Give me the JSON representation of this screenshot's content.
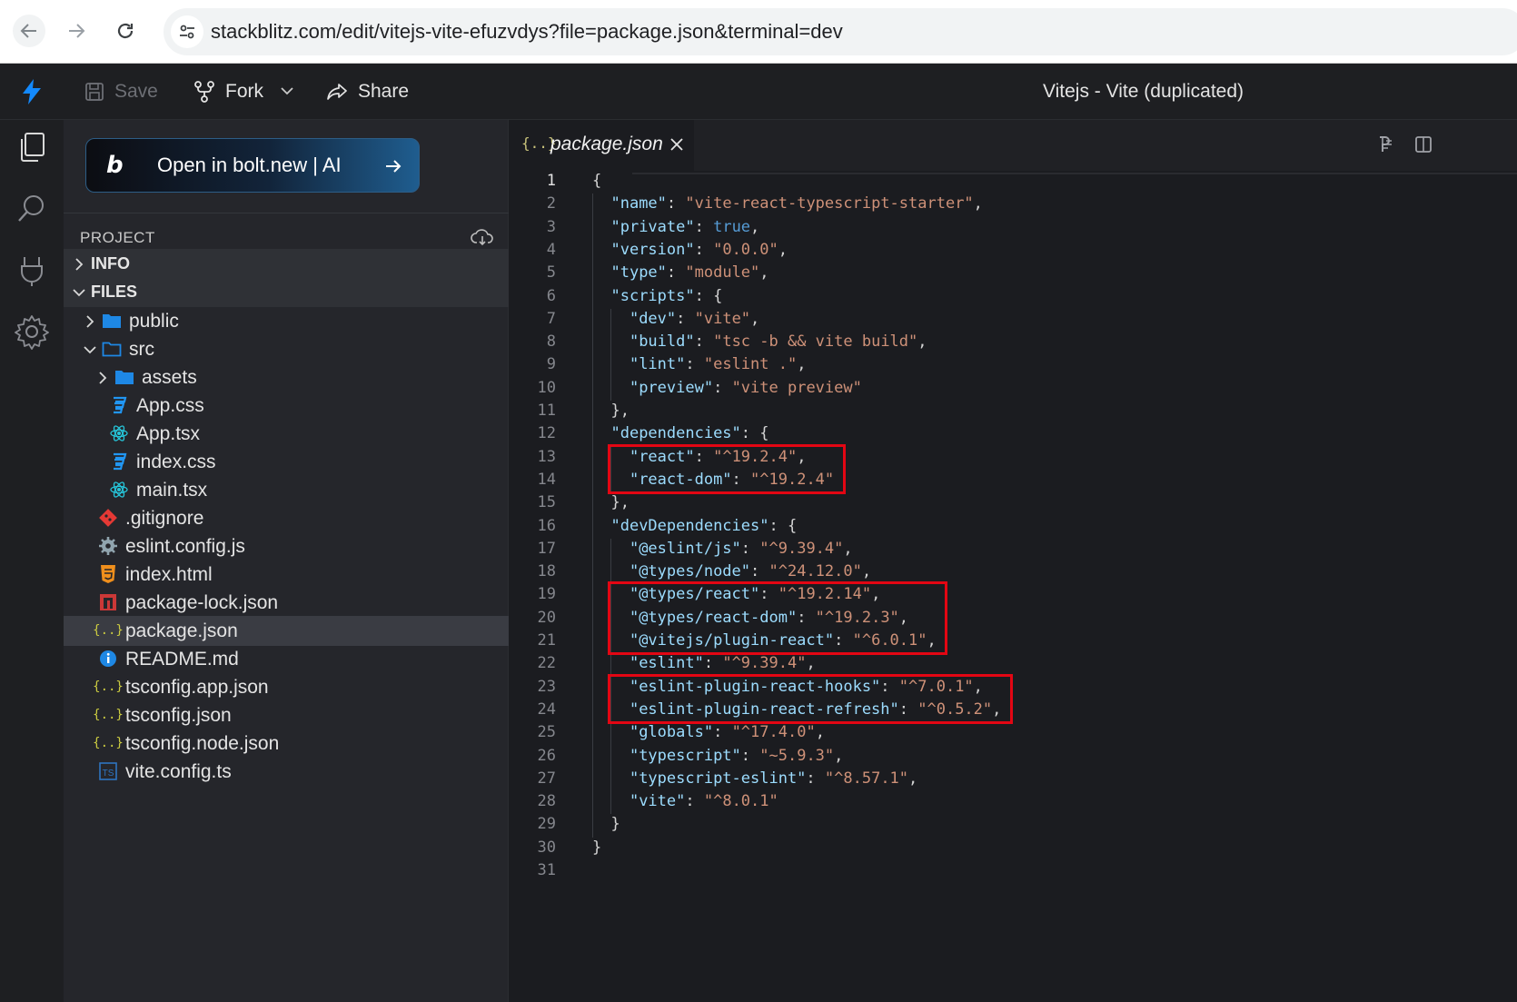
{
  "browser": {
    "url": "stackblitz.com/edit/vitejs-vite-efuzvdys?file=package.json&terminal=dev"
  },
  "header": {
    "save_label": "Save",
    "fork_label": "Fork",
    "share_label": "Share",
    "title": "Vitejs - Vite (duplicated)"
  },
  "sidebar": {
    "banner_text": "Open in bolt.new | AI",
    "banner_logo": "b",
    "project_label": "PROJECT",
    "sections": {
      "info": "INFO",
      "files": "FILES"
    },
    "tree": [
      {
        "name": "public",
        "type": "folder",
        "expanded": false,
        "depth": 1
      },
      {
        "name": "src",
        "type": "folder",
        "expanded": true,
        "depth": 1
      },
      {
        "name": "assets",
        "type": "folder",
        "expanded": false,
        "depth": 2
      },
      {
        "name": "App.css",
        "type": "css",
        "depth": 2
      },
      {
        "name": "App.tsx",
        "type": "react",
        "depth": 2
      },
      {
        "name": "index.css",
        "type": "css",
        "depth": 2
      },
      {
        "name": "main.tsx",
        "type": "react",
        "depth": 2
      },
      {
        "name": ".gitignore",
        "type": "git",
        "depth": 1
      },
      {
        "name": "eslint.config.js",
        "type": "gear",
        "depth": 1
      },
      {
        "name": "index.html",
        "type": "html",
        "depth": 1
      },
      {
        "name": "package-lock.json",
        "type": "npm",
        "depth": 1
      },
      {
        "name": "package.json",
        "type": "json",
        "depth": 1,
        "selected": true
      },
      {
        "name": "README.md",
        "type": "info",
        "depth": 1
      },
      {
        "name": "tsconfig.app.json",
        "type": "json",
        "depth": 1
      },
      {
        "name": "tsconfig.json",
        "type": "json",
        "depth": 1
      },
      {
        "name": "tsconfig.node.json",
        "type": "json",
        "depth": 1
      },
      {
        "name": "vite.config.ts",
        "type": "ts",
        "depth": 1
      }
    ]
  },
  "editor": {
    "tab_label": "package.json",
    "tab_icon": "{..}",
    "lines": [
      [
        [
          "p",
          "{"
        ]
      ],
      [
        [
          "p",
          "  "
        ],
        [
          "k",
          "\"name\""
        ],
        [
          "p",
          ": "
        ],
        [
          "s",
          "\"vite-react-typescript-starter\""
        ],
        [
          "p",
          ","
        ]
      ],
      [
        [
          "p",
          "  "
        ],
        [
          "k",
          "\"private\""
        ],
        [
          "p",
          ": "
        ],
        [
          "b",
          "true"
        ],
        [
          "p",
          ","
        ]
      ],
      [
        [
          "p",
          "  "
        ],
        [
          "k",
          "\"version\""
        ],
        [
          "p",
          ": "
        ],
        [
          "s",
          "\"0.0.0\""
        ],
        [
          "p",
          ","
        ]
      ],
      [
        [
          "p",
          "  "
        ],
        [
          "k",
          "\"type\""
        ],
        [
          "p",
          ": "
        ],
        [
          "s",
          "\"module\""
        ],
        [
          "p",
          ","
        ]
      ],
      [
        [
          "p",
          "  "
        ],
        [
          "k",
          "\"scripts\""
        ],
        [
          "p",
          ": {"
        ]
      ],
      [
        [
          "p",
          "    "
        ],
        [
          "k",
          "\"dev\""
        ],
        [
          "p",
          ": "
        ],
        [
          "s",
          "\"vite\""
        ],
        [
          "p",
          ","
        ]
      ],
      [
        [
          "p",
          "    "
        ],
        [
          "k",
          "\"build\""
        ],
        [
          "p",
          ": "
        ],
        [
          "s",
          "\"tsc -b && vite build\""
        ],
        [
          "p",
          ","
        ]
      ],
      [
        [
          "p",
          "    "
        ],
        [
          "k",
          "\"lint\""
        ],
        [
          "p",
          ": "
        ],
        [
          "s",
          "\"eslint .\""
        ],
        [
          "p",
          ","
        ]
      ],
      [
        [
          "p",
          "    "
        ],
        [
          "k",
          "\"preview\""
        ],
        [
          "p",
          ": "
        ],
        [
          "s",
          "\"vite preview\""
        ]
      ],
      [
        [
          "p",
          "  },"
        ]
      ],
      [
        [
          "p",
          "  "
        ],
        [
          "k",
          "\"dependencies\""
        ],
        [
          "p",
          ": {"
        ]
      ],
      [
        [
          "p",
          "    "
        ],
        [
          "k",
          "\"react\""
        ],
        [
          "p",
          ": "
        ],
        [
          "s",
          "\"^19.2.4\""
        ],
        [
          "p",
          ","
        ]
      ],
      [
        [
          "p",
          "    "
        ],
        [
          "k",
          "\"react-dom\""
        ],
        [
          "p",
          ": "
        ],
        [
          "s",
          "\"^19.2.4\""
        ]
      ],
      [
        [
          "p",
          "  },"
        ]
      ],
      [
        [
          "p",
          "  "
        ],
        [
          "k",
          "\"devDependencies\""
        ],
        [
          "p",
          ": {"
        ]
      ],
      [
        [
          "p",
          "    "
        ],
        [
          "k",
          "\"@eslint/js\""
        ],
        [
          "p",
          ": "
        ],
        [
          "s",
          "\"^9.39.4\""
        ],
        [
          "p",
          ","
        ]
      ],
      [
        [
          "p",
          "    "
        ],
        [
          "k",
          "\"@types/node\""
        ],
        [
          "p",
          ": "
        ],
        [
          "s",
          "\"^24.12.0\""
        ],
        [
          "p",
          ","
        ]
      ],
      [
        [
          "p",
          "    "
        ],
        [
          "k",
          "\"@types/react\""
        ],
        [
          "p",
          ": "
        ],
        [
          "s",
          "\"^19.2.14\""
        ],
        [
          "p",
          ","
        ]
      ],
      [
        [
          "p",
          "    "
        ],
        [
          "k",
          "\"@types/react-dom\""
        ],
        [
          "p",
          ": "
        ],
        [
          "s",
          "\"^19.2.3\""
        ],
        [
          "p",
          ","
        ]
      ],
      [
        [
          "p",
          "    "
        ],
        [
          "k",
          "\"@vitejs/plugin-react\""
        ],
        [
          "p",
          ": "
        ],
        [
          "s",
          "\"^6.0.1\""
        ],
        [
          "p",
          ","
        ]
      ],
      [
        [
          "p",
          "    "
        ],
        [
          "k",
          "\"eslint\""
        ],
        [
          "p",
          ": "
        ],
        [
          "s",
          "\"^9.39.4\""
        ],
        [
          "p",
          ","
        ]
      ],
      [
        [
          "p",
          "    "
        ],
        [
          "k",
          "\"eslint-plugin-react-hooks\""
        ],
        [
          "p",
          ": "
        ],
        [
          "s",
          "\"^7.0.1\""
        ],
        [
          "p",
          ","
        ]
      ],
      [
        [
          "p",
          "    "
        ],
        [
          "k",
          "\"eslint-plugin-react-refresh\""
        ],
        [
          "p",
          ": "
        ],
        [
          "s",
          "\"^0.5.2\""
        ],
        [
          "p",
          ","
        ]
      ],
      [
        [
          "p",
          "    "
        ],
        [
          "k",
          "\"globals\""
        ],
        [
          "p",
          ": "
        ],
        [
          "s",
          "\"^17.4.0\""
        ],
        [
          "p",
          ","
        ]
      ],
      [
        [
          "p",
          "    "
        ],
        [
          "k",
          "\"typescript\""
        ],
        [
          "p",
          ": "
        ],
        [
          "s",
          "\"~5.9.3\""
        ],
        [
          "p",
          ","
        ]
      ],
      [
        [
          "p",
          "    "
        ],
        [
          "k",
          "\"typescript-eslint\""
        ],
        [
          "p",
          ": "
        ],
        [
          "s",
          "\"^8.57.1\""
        ],
        [
          "p",
          ","
        ]
      ],
      [
        [
          "p",
          "    "
        ],
        [
          "k",
          "\"vite\""
        ],
        [
          "p",
          ": "
        ],
        [
          "s",
          "\"^8.0.1\""
        ]
      ],
      [
        [
          "p",
          "  }"
        ]
      ],
      [
        [
          "p",
          "}"
        ]
      ],
      [
        [
          "p",
          ""
        ]
      ]
    ],
    "highlight_groups": [
      [
        13,
        14
      ],
      [
        19,
        21
      ],
      [
        23,
        24
      ]
    ]
  },
  "colors": {
    "accent": "#1389fd",
    "highlight_border": "#e30613",
    "json_key": "#9cdcfe",
    "json_string": "#ce9178",
    "json_bool": "#569cd6"
  }
}
